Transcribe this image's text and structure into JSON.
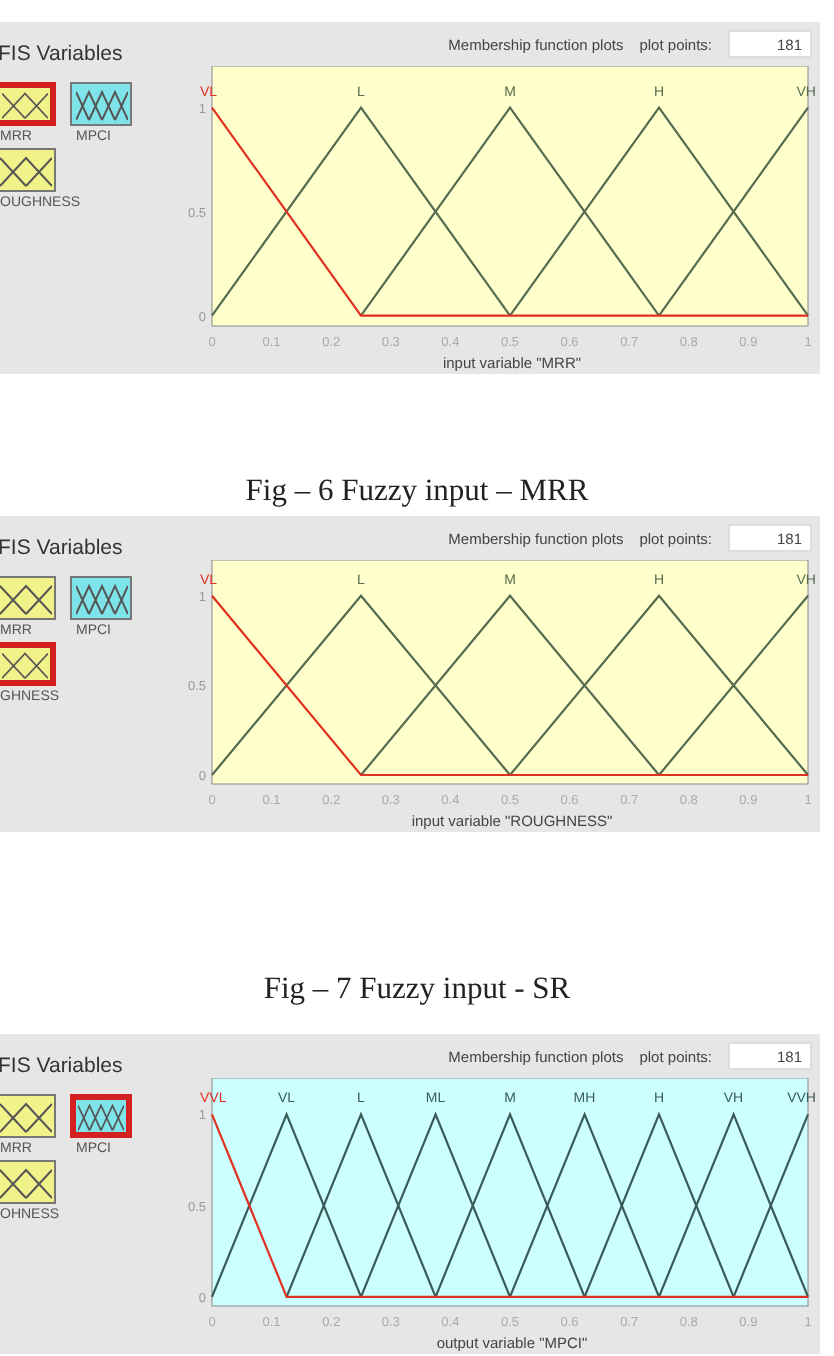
{
  "figures": [
    {
      "panel": {
        "title": "FIS Variables",
        "kind": "input",
        "variables": [
          {
            "label": "MRR",
            "kind": "input",
            "selected": true
          },
          {
            "label": "MPCI",
            "kind": "output",
            "selected": false
          },
          {
            "label": "OUGHNESS",
            "kind": "input",
            "selected": false
          }
        ],
        "header": "Membership function plots",
        "points_label": "plot points:",
        "points_value": "181",
        "chart_data": {
          "type": "line",
          "xlabel": "input variable \"MRR\"",
          "x": [
            0,
            0.25,
            0.5,
            0.75,
            1
          ],
          "xlim": [
            0,
            1
          ],
          "ylim": [
            -0.05,
            1.2
          ],
          "xticks": [
            0,
            0.1,
            0.2,
            0.3,
            0.4,
            0.5,
            0.6,
            0.7,
            0.8,
            0.9,
            1
          ],
          "yticks": [
            {
              "value": 0,
              "label": "0"
            },
            {
              "value": 0.5,
              "label": "0.5"
            },
            {
              "value": 1,
              "label": "1"
            }
          ],
          "series": [
            {
              "name": "VL",
              "color": "#e03020",
              "values": [
                1,
                0,
                0,
                0,
                0
              ]
            },
            {
              "name": "L",
              "color": "#556b50",
              "values": [
                0,
                1,
                0,
                null,
                null
              ]
            },
            {
              "name": "M",
              "color": "#556b50",
              "values": [
                null,
                0,
                1,
                0,
                null
              ]
            },
            {
              "name": "H",
              "color": "#556b50",
              "values": [
                null,
                null,
                0,
                1,
                0
              ]
            },
            {
              "name": "VH",
              "color": "#556b50",
              "values": [
                null,
                null,
                null,
                0,
                1
              ]
            }
          ]
        }
      },
      "caption": "Fig – 6 Fuzzy input – MRR"
    },
    {
      "panel": {
        "title": "FIS Variables",
        "kind": "input",
        "variables": [
          {
            "label": "MRR",
            "kind": "input",
            "selected": false
          },
          {
            "label": "MPCI",
            "kind": "output",
            "selected": false
          },
          {
            "label": "GHNESS",
            "kind": "input",
            "selected": true
          }
        ],
        "header": "Membership function plots",
        "points_label": "plot points:",
        "points_value": "181",
        "chart_data": {
          "type": "line",
          "xlabel": "input variable \"ROUGHNESS\"",
          "x": [
            0,
            0.25,
            0.5,
            0.75,
            1
          ],
          "xlim": [
            0,
            1
          ],
          "ylim": [
            -0.05,
            1.2
          ],
          "xticks": [
            0,
            0.1,
            0.2,
            0.3,
            0.4,
            0.5,
            0.6,
            0.7,
            0.8,
            0.9,
            1
          ],
          "yticks": [
            {
              "value": 0,
              "label": "0"
            },
            {
              "value": 0.5,
              "label": "0.5"
            },
            {
              "value": 1,
              "label": "1"
            }
          ],
          "series": [
            {
              "name": "VL",
              "color": "#e03020",
              "values": [
                1,
                0,
                0,
                0,
                0
              ]
            },
            {
              "name": "L",
              "color": "#556b50",
              "values": [
                0,
                1,
                0,
                null,
                null
              ]
            },
            {
              "name": "M",
              "color": "#556b50",
              "values": [
                null,
                0,
                1,
                0,
                null
              ]
            },
            {
              "name": "H",
              "color": "#556b50",
              "values": [
                null,
                null,
                0,
                1,
                0
              ]
            },
            {
              "name": "VH",
              "color": "#556b50",
              "values": [
                null,
                null,
                null,
                0,
                1
              ]
            }
          ]
        }
      },
      "caption": "Fig – 7 Fuzzy input - SR"
    },
    {
      "panel": {
        "title": "FIS Variables",
        "kind": "output",
        "variables": [
          {
            "label": "MRR",
            "kind": "input",
            "selected": false
          },
          {
            "label": "MPCI",
            "kind": "output",
            "selected": true
          },
          {
            "label": "OHNESS",
            "kind": "input",
            "selected": false
          }
        ],
        "header": "Membership function plots",
        "points_label": "plot points:",
        "points_value": "181",
        "chart_data": {
          "type": "line",
          "xlabel": "output variable \"MPCI\"",
          "x": [
            0,
            0.125,
            0.25,
            0.375,
            0.5,
            0.625,
            0.75,
            0.875,
            1
          ],
          "xlim": [
            0,
            1
          ],
          "ylim": [
            -0.05,
            1.2
          ],
          "xticks": [
            0,
            0.1,
            0.2,
            0.3,
            0.4,
            0.5,
            0.6,
            0.7,
            0.8,
            0.9,
            1
          ],
          "yticks": [
            {
              "value": 0,
              "label": "0"
            },
            {
              "value": 0.5,
              "label": "0.5"
            },
            {
              "value": 1,
              "label": "1"
            }
          ],
          "series": [
            {
              "name": "VVL",
              "color": "#e03020",
              "values": [
                1,
                0,
                0,
                0,
                0,
                0,
                0,
                0,
                0
              ]
            },
            {
              "name": "VL",
              "color": "#3a5a58",
              "values": [
                0,
                1,
                0,
                null,
                null,
                null,
                null,
                null,
                null
              ]
            },
            {
              "name": "L",
              "color": "#3a5a58",
              "values": [
                null,
                0,
                1,
                0,
                null,
                null,
                null,
                null,
                null
              ]
            },
            {
              "name": "ML",
              "color": "#3a5a58",
              "values": [
                null,
                null,
                0,
                1,
                0,
                null,
                null,
                null,
                null
              ]
            },
            {
              "name": "M",
              "color": "#3a5a58",
              "values": [
                null,
                null,
                null,
                0,
                1,
                0,
                null,
                null,
                null
              ]
            },
            {
              "name": "MH",
              "color": "#3a5a58",
              "values": [
                null,
                null,
                null,
                null,
                0,
                1,
                0,
                null,
                null
              ]
            },
            {
              "name": "H",
              "color": "#3a5a58",
              "values": [
                null,
                null,
                null,
                null,
                null,
                0,
                1,
                0,
                null
              ]
            },
            {
              "name": "VH",
              "color": "#3a5a58",
              "values": [
                null,
                null,
                null,
                null,
                null,
                null,
                0,
                1,
                0
              ]
            },
            {
              "name": "VVH",
              "color": "#3a5a58",
              "values": [
                null,
                null,
                null,
                null,
                null,
                null,
                null,
                0,
                1
              ]
            }
          ]
        }
      }
    }
  ]
}
